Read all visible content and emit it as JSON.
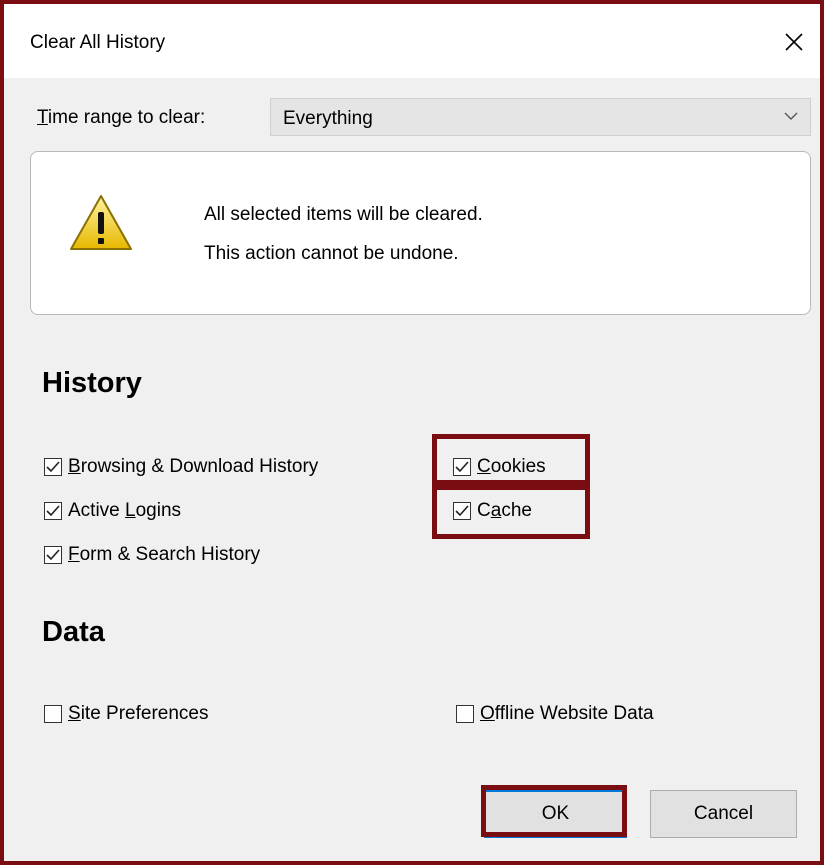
{
  "window": {
    "title": "Clear All History"
  },
  "range": {
    "label_prefix": "T",
    "label_rest": "ime range to clear:",
    "selected": "Everything"
  },
  "warning": {
    "line1": "All selected items will be cleared.",
    "line2": "This action cannot be undone."
  },
  "history": {
    "title": "History",
    "items": [
      {
        "key": "B",
        "rest": "rowsing & Download History",
        "checked": true
      },
      {
        "key": "C",
        "rest": "ookies",
        "checked": true
      },
      {
        "pre": "Active ",
        "key": "L",
        "rest": "ogins",
        "checked": true
      },
      {
        "pre": "C",
        "key": "a",
        "rest": "che",
        "checked": true
      },
      {
        "key": "F",
        "rest": "orm & Search History",
        "checked": true
      }
    ]
  },
  "data_section": {
    "title": "Data",
    "items": [
      {
        "key": "S",
        "rest": "ite Preferences",
        "checked": false
      },
      {
        "key": "O",
        "rest": "ffline Website Data",
        "checked": false
      }
    ]
  },
  "buttons": {
    "ok": "OK",
    "cancel": "Cancel"
  },
  "colors": {
    "highlight": "#7a0d12",
    "focus": "#0078d7"
  }
}
